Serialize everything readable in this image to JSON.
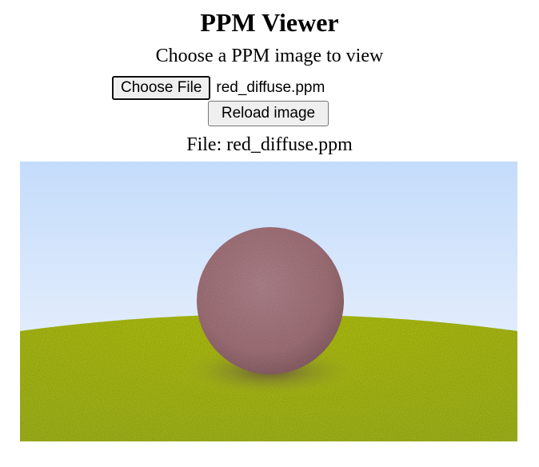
{
  "header": {
    "title": "PPM Viewer",
    "subtitle": "Choose a PPM image to view"
  },
  "file_input": {
    "button_label": "Choose File",
    "selected_file": "red_diffuse.ppm"
  },
  "reload": {
    "button_label": "Reload image"
  },
  "file_label": "File: red_diffuse.ppm",
  "render": {
    "icon": "rendered-ppm-image",
    "colors": {
      "sky_top": "#c4dcfb",
      "sky_bottom": "#f4f7fd",
      "ground": "#a9bd1a",
      "ground_light": "#b8c90e",
      "sphere": "#a7757d",
      "sphere_shadow": "#5f4a45"
    }
  }
}
